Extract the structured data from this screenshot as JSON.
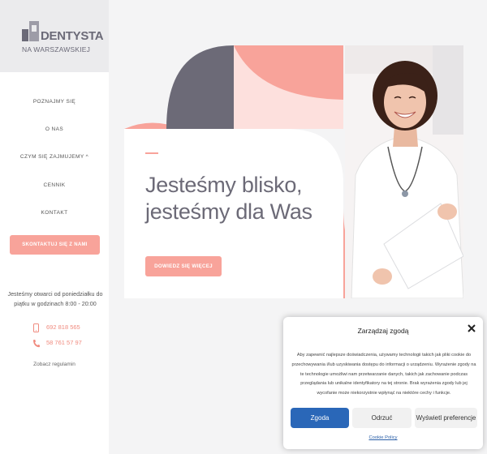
{
  "logo": {
    "title": "DENTYSTA",
    "subtitle": "NA WARSZAWSKIEJ"
  },
  "nav": {
    "items": [
      {
        "label": "POZNAJMY SIĘ"
      },
      {
        "label": "O NAS"
      },
      {
        "label": "CZYM SIĘ ZAJMUJEMY ^"
      },
      {
        "label": "CENNIK"
      },
      {
        "label": "KONTAKT"
      }
    ],
    "contact_button": "SKONTAKTUJ SIĘ Z NAMI"
  },
  "sidebar_info": {
    "hours": "Jesteśmy otwarci od poniedziałku do piątku w godzinach 8:00 - 20:00",
    "phone1": "692 818 565",
    "phone2": "58 761 57 97",
    "terms": "Zobacz regulamin"
  },
  "hero": {
    "line1": "Jesteśmy blisko,",
    "line2": "jesteśmy dla Was",
    "button": "DOWIEDZ SIĘ WIĘCEJ"
  },
  "cookie": {
    "title": "Zarządzaj zgodą",
    "body": "Aby zapewnić najlepsze doświadczenia, używamy technologii takich jak pliki cookie do przechowywania i/lub uzyskiwania dostępu do informacji o urządzeniu. Wyrażenie zgody na te technologie umożliwi nam przetwarzanie danych, takich jak zachowanie podczas przeglądania lub unikalne identyfikatory na tej stronie. Brak wyrażenia zgody lub jej wycofanie może niekorzystnie wpłynąć na niektóre cechy i funkcje.",
    "accept": "Zgoda",
    "reject": "Odrzuć",
    "preferences": "Wyświetl preferencje",
    "policy": "Cookie Policy"
  },
  "colors": {
    "accent": "#f8a39a",
    "dark": "#6c6a77",
    "blue": "#2a67b8"
  }
}
